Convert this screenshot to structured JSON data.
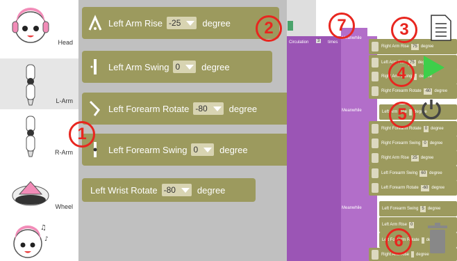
{
  "sidebar": {
    "categories": [
      {
        "label": "Head",
        "icon": "robot-head-icon"
      },
      {
        "label": "L-Arm",
        "icon": "left-arm-icon",
        "selected": true
      },
      {
        "label": "R-Arm",
        "icon": "right-arm-icon"
      },
      {
        "label": "Wheel",
        "icon": "wheel-icon"
      },
      {
        "label": "",
        "icon": "music-head-icon"
      }
    ]
  },
  "flyout": {
    "blocks": [
      {
        "label": "Left Arm Rise",
        "value": "-25",
        "unit": "degree"
      },
      {
        "label": "Left Arm Swing",
        "value": "0",
        "unit": "degree"
      },
      {
        "label": "Left Forearm Rotate",
        "value": "-80",
        "unit": "degree"
      },
      {
        "label": "Left Forearm Swing",
        "value": "0",
        "unit": "degree"
      },
      {
        "label": "Left Wrist Rotate",
        "value": "-80",
        "unit": "degree"
      }
    ]
  },
  "workspace": {
    "circulation": {
      "label": "Circulation",
      "value": "3",
      "suffix": "times"
    },
    "meanwhile_label": "Meanwhile",
    "mini_blocks": [
      {
        "label": "Right Arm Rise",
        "value": "75",
        "unit": "degree"
      },
      {
        "label": "Left Arm Rise",
        "value": "75",
        "unit": "degree"
      },
      {
        "label": "Right Arm Swing",
        "value": "",
        "unit": "degree"
      },
      {
        "label": "Right Forearm Rotate",
        "value": "-60",
        "unit": "degree"
      },
      {
        "label": "Left Arm Rise",
        "value": "",
        "unit": "degree"
      },
      {
        "label": "Right Forearm Rotate",
        "value": "0",
        "unit": "degree"
      },
      {
        "label": "Right Forearm Swing",
        "value": "0",
        "unit": "degree"
      },
      {
        "label": "Right Arm Rise",
        "value": "25",
        "unit": "degree"
      },
      {
        "label": "Left Forearm Swing",
        "value": "60",
        "unit": "degree"
      },
      {
        "label": "Left Forearm Rotate",
        "value": "-60",
        "unit": "degree"
      },
      {
        "label": "Left Forearm Swing",
        "value": "5",
        "unit": "degree"
      },
      {
        "label": "Left Arm Rise",
        "value": "0",
        "unit": ""
      },
      {
        "label": "Left Forearm Rotate",
        "value": "",
        "unit": "degree"
      },
      {
        "label": "Right Arm Rise",
        "value": "",
        "unit": "degree"
      }
    ]
  },
  "toolbar": {
    "save_icon": "document-icon",
    "play_icon": "play-icon",
    "power_icon": "power-icon",
    "trash_icon": "trash-icon"
  },
  "annotations": [
    "1",
    "2",
    "3",
    "4",
    "5",
    "6",
    "7"
  ],
  "colors": {
    "block": "#9c9a5e",
    "purple": "#9b55b5",
    "annotation": "#e8261f",
    "play": "#3ecf4a"
  }
}
